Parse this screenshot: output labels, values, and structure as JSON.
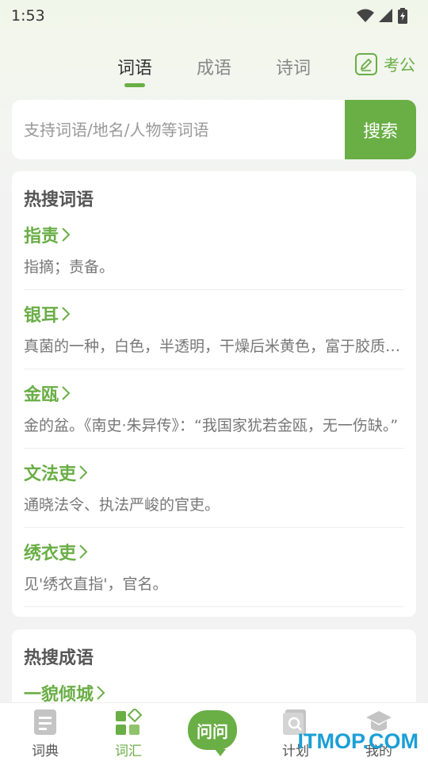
{
  "status_bar": {
    "time": "1:53"
  },
  "top_tabs": [
    {
      "label": "词语",
      "active": true
    },
    {
      "label": "成语",
      "active": false
    },
    {
      "label": "诗词",
      "active": false
    }
  ],
  "kaogong": {
    "label": "考公",
    "icon": "edit-note-icon"
  },
  "search": {
    "placeholder": "支持词语/地名/人物等词语",
    "value": "",
    "button_label": "搜索"
  },
  "hot_words": {
    "title": "热搜词语",
    "items": [
      {
        "word": "指责",
        "definition": "指摘；责备。"
      },
      {
        "word": "银耳",
        "definition": "真菌的一种，白色，半透明，干燥后米黄色，富于胶质，可入药，也用作食品。"
      },
      {
        "word": "金瓯",
        "definition": "金的盆。《南史·朱异传》：“我国家犹若金瓯，无一伤缺。”"
      },
      {
        "word": "文法吏",
        "definition": "通晓法令、执法严峻的官吏。"
      },
      {
        "word": "绣衣吏",
        "definition": "见'绣衣直指'，官名。"
      }
    ]
  },
  "hot_idioms": {
    "title": "热搜成语",
    "items": [
      {
        "word": "一貌倾城"
      }
    ]
  },
  "bottom_nav": [
    {
      "label": "词典",
      "icon": "document-icon",
      "active": false
    },
    {
      "label": "词汇",
      "icon": "grid-icon",
      "active": true
    },
    {
      "label": "问问",
      "icon": "chat-bubble-icon",
      "active": false
    },
    {
      "label": "计划",
      "icon": "search-document-icon",
      "active": false
    },
    {
      "label": "我的",
      "icon": "graduation-cap-icon",
      "active": false
    }
  ],
  "watermark": "ITMOP.COM",
  "colors": {
    "accent": "#6aae46",
    "background": "#f2f2f2",
    "watermark": "#1a9fd6"
  }
}
